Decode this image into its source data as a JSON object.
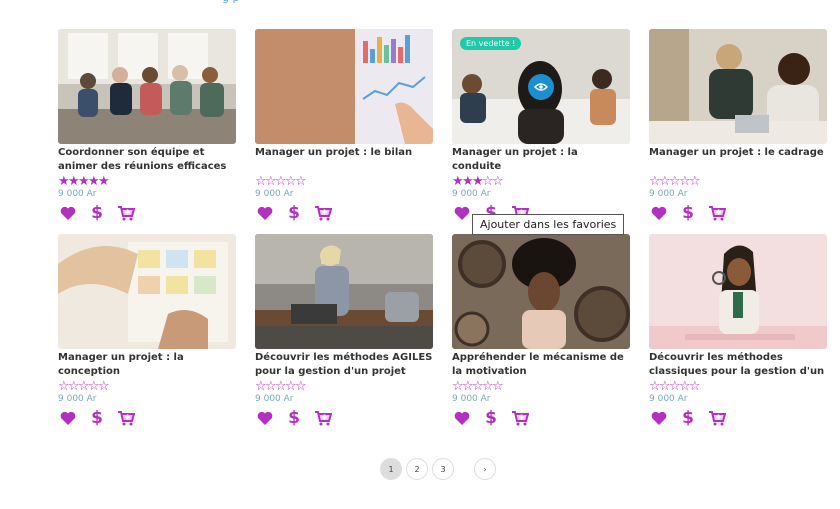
{
  "header": {
    "fragment": "g          p"
  },
  "colors": {
    "accent": "#b430c0",
    "badge": "#1fc9a9",
    "eye": "#1d8fd1",
    "price": "#7aa8b8"
  },
  "courses": [
    {
      "title": "Coordonner son équipe et animer des réunions efficaces",
      "rating": 5,
      "price": "9 000 Ar",
      "badge": "",
      "preview": false
    },
    {
      "title": "Manager un projet : le bilan",
      "rating": 0,
      "price": "9 000 Ar",
      "badge": "",
      "preview": false
    },
    {
      "title": "Manager un projet : la conduite",
      "rating": 3,
      "price": "9 000 Ar",
      "badge": "En vedette !",
      "preview": true
    },
    {
      "title": "Manager un projet : le cadrage",
      "rating": 0,
      "price": "9 000 Ar",
      "badge": "",
      "preview": false
    },
    {
      "title": "Manager un projet : la conception",
      "rating": 0,
      "price": "9 000 Ar",
      "badge": "",
      "preview": false
    },
    {
      "title": "Découvrir les méthodes AGILES pour la gestion d'un projet",
      "rating": 0,
      "price": "9 000 Ar",
      "badge": "",
      "preview": false
    },
    {
      "title": "Appréhender le mécanisme de la motivation",
      "rating": 0,
      "price": "9 000 Ar",
      "badge": "",
      "preview": false
    },
    {
      "title": "Découvrir les méthodes classiques pour la gestion d'un",
      "rating": 0,
      "price": "9 000 Ar",
      "badge": "",
      "preview": false
    }
  ],
  "tooltip": "Ajouter dans les favories",
  "pagination": {
    "pages": [
      "1",
      "2",
      "3"
    ],
    "current": "1",
    "next": "›"
  },
  "icons": {
    "favorite": "heart-icon",
    "price": "dollar-icon",
    "cart": "cart-add-icon",
    "preview": "eye-icon"
  }
}
